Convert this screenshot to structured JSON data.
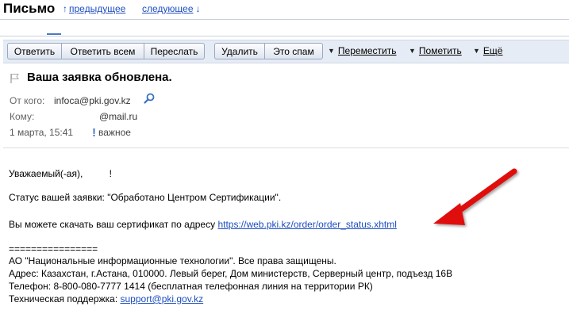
{
  "header": {
    "title": "Письмо",
    "prev_label": "предыдущее",
    "next_label": "следующее",
    "prev_arrow": "↑",
    "next_arrow": "↓"
  },
  "toolbar": {
    "reply": "Ответить",
    "reply_all": "Ответить всем",
    "forward": "Переслать",
    "delete": "Удалить",
    "spam": "Это спам",
    "move": "Переместить",
    "mark": "Пометить",
    "more": "Ещё",
    "dropdown_glyph": "▼"
  },
  "message": {
    "subject": "Ваша заявка обновлена.",
    "from_label": "От кого:",
    "from_value": "infoca@pki.gov.kz",
    "to_label": "Кому:",
    "to_value": "@mail.ru",
    "date": "1 марта, 15:41",
    "important_mark": "!",
    "important_label": "важное"
  },
  "body": {
    "greeting_start": "Уважаемый(-ая),",
    "greeting_end": "!",
    "status": "Статус вашей заявки: \"Обработано Центром Сертификации\".",
    "download_text": "Вы можете скачать ваш сертификат по адресу",
    "download_link": "https://web.pki.kz/order/order_status.xhtml",
    "separator": "================",
    "sig1": "АО \"Национальные информационные технологии\". Все права защищены.",
    "sig2": "Адрес: Казахстан, г.Астана, 010000. Левый берег, Дом министерств, Серверный центр, подъезд 16В",
    "sig3": "Телефон: 8-800-080-7777 1414 (бесплатная телефонная линия на территории РК)",
    "support_label": "Техническая поддержка:",
    "support_email": "support@pki.gov.kz"
  },
  "colors": {
    "link": "#1d4ec0",
    "toolbar_bg": "#e6ecf5",
    "arrow": "#e01010"
  }
}
